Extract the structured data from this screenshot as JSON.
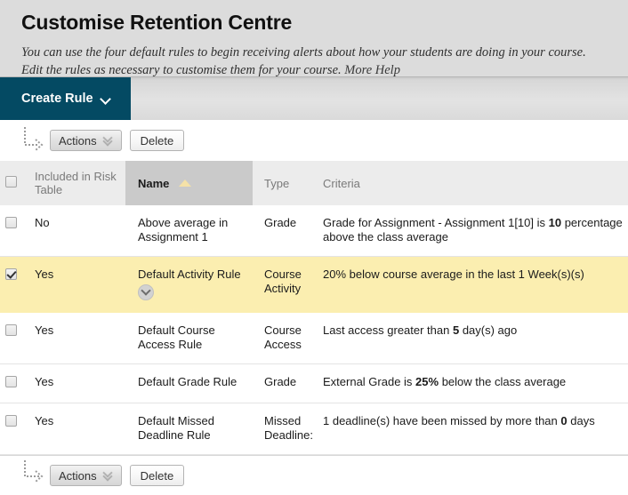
{
  "header": {
    "title": "Customise Retention Centre",
    "instructions_line1": "You can use the four default rules to begin receiving alerts about how your students are doing in your course.",
    "instructions_line2": "Edit the rules as necessary to customise them for your course.",
    "more_help_label": "More Help"
  },
  "action_bar": {
    "create_rule_label": "Create Rule",
    "create_rule_icon": "chevron-down-icon",
    "accent_color": "#044a63"
  },
  "toolbar": {
    "actions_label": "Actions",
    "actions_icon": "double-chevron-down-icon",
    "delete_label": "Delete",
    "jump_arrow_icon": "dotted-elbow-arrow-icon"
  },
  "table": {
    "columns": [
      {
        "key": "checkbox",
        "label": ""
      },
      {
        "key": "included",
        "label": "Included in Risk Table"
      },
      {
        "key": "name",
        "label": "Name",
        "sorted": "ascending",
        "sort_icon": "sort-ascending-triangle-icon"
      },
      {
        "key": "type",
        "label": "Type"
      },
      {
        "key": "criteria",
        "label": "Criteria"
      }
    ],
    "header_select_all_checked": false,
    "rows": [
      {
        "checked": false,
        "included": "No",
        "name": "Above average in Assignment 1",
        "type": "Grade",
        "criteria_pre": "Grade for Assignment - Assignment 1[10] is ",
        "criteria_bold": "10",
        "criteria_post": " percentage above the class average",
        "selected": false,
        "has_context_menu": false
      },
      {
        "checked": true,
        "included": "Yes",
        "name": "Default Activity Rule",
        "type": "Course Activity",
        "criteria_pre": "20% below course average in the last 1 Week(s)(s)",
        "criteria_bold": "",
        "criteria_post": "",
        "selected": true,
        "has_context_menu": true,
        "context_menu_icon": "chevron-down-circle-icon"
      },
      {
        "checked": false,
        "included": "Yes",
        "name": "Default Course Access Rule",
        "type": "Course Access",
        "criteria_pre": "Last access greater than ",
        "criteria_bold": "5",
        "criteria_post": " day(s) ago",
        "selected": false,
        "has_context_menu": false
      },
      {
        "checked": false,
        "included": "Yes",
        "name": "Default Grade Rule",
        "type": "Grade",
        "criteria_pre": "External Grade is ",
        "criteria_bold": "25%",
        "criteria_post": " below the class average",
        "selected": false,
        "has_context_menu": false
      },
      {
        "checked": false,
        "included": "Yes",
        "name": "Default Missed Deadline Rule",
        "type": "Missed Deadline:",
        "criteria_pre": "1 deadline(s) have been missed by more than ",
        "criteria_bold": "0",
        "criteria_post": " days",
        "selected": false,
        "has_context_menu": false
      }
    ]
  },
  "colors": {
    "header_background": "#dcdcdc",
    "accent": "#044a63",
    "selected_row": "#fbeeb0",
    "table_header": "#ececec",
    "sorted_column_header": "#cacaca"
  }
}
